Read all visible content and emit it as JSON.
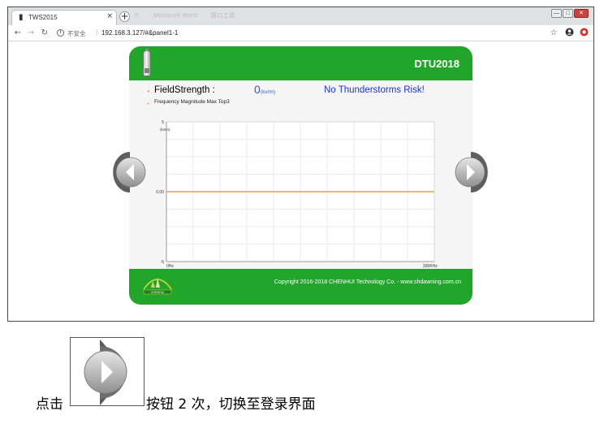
{
  "browser": {
    "tab_title": "TWS2015",
    "tab_favicon": "device-icon",
    "tab_close": "×",
    "new_tab": "+",
    "background_tabs": [
      "0",
      ".Microsoft Word",
      "圆口工具"
    ],
    "window_controls": [
      "—",
      "□",
      "✕"
    ],
    "nav": {
      "back": "←",
      "forward": "→",
      "reload": "↻"
    },
    "security_label": "不安全",
    "url": "192.168.3.127/#&panel1-1",
    "toolbar_icons": [
      "star-icon",
      "account-icon",
      "extension-icon"
    ]
  },
  "panel": {
    "title": "DTU2018",
    "field_label": "FieldStrength :",
    "field_value": "0",
    "field_unit": "(kv/m)",
    "risk_status": "No Thunderstorms Risk!",
    "chart_label": "Frequency Magnitude Max Top3",
    "footer_text": "Copyright 2016-2018 CHENHUI Technology Co. - www.shdawning.com.cn",
    "footer_logo_text": "CHENHUI"
  },
  "chart_data": {
    "type": "line",
    "x_tick_labels": [
      "0Hz",
      "330KHz"
    ],
    "y_tick_labels": [
      "5",
      "0.00",
      "-5"
    ],
    "y_unit": "(kv/m)",
    "xlim": [
      0,
      330
    ],
    "ylim": [
      -5,
      5
    ],
    "grid": true,
    "series": [
      {
        "color": "#f0a040",
        "x": [
          0,
          330
        ],
        "y": [
          0,
          0
        ]
      }
    ]
  },
  "caption": {
    "prefix": "点击",
    "suffix": "按钮 2 次，切换至登录界面"
  },
  "colors": {
    "brand_green": "#21a52b",
    "accent_orange": "#f3a73b",
    "status_blue": "#1c34d6"
  }
}
